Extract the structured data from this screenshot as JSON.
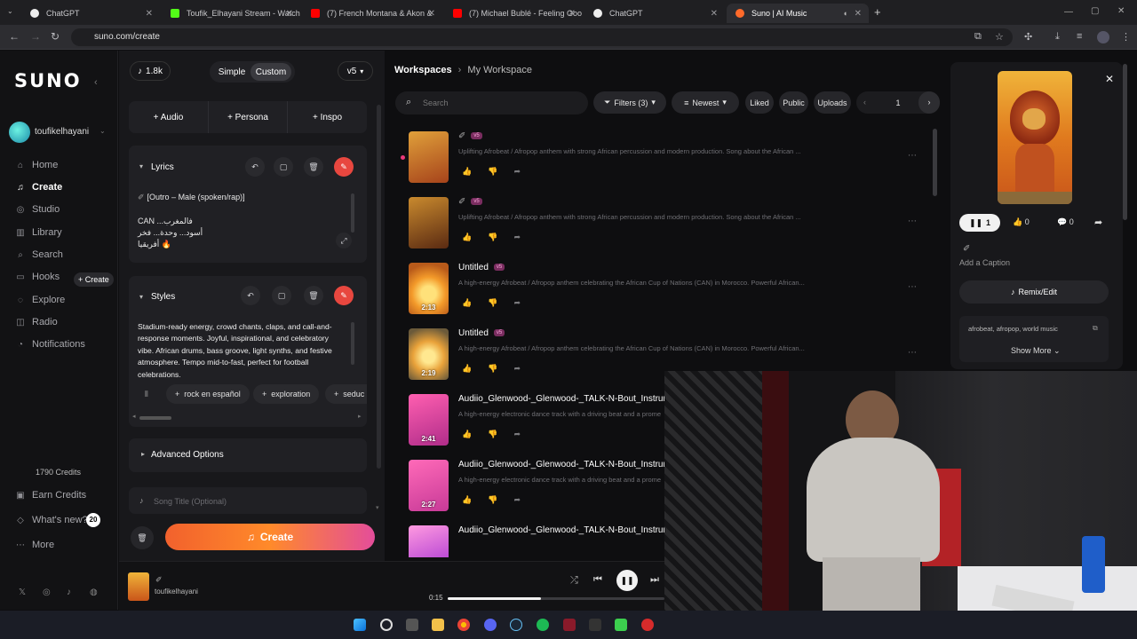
{
  "browser": {
    "tabs": [
      {
        "title": "ChatGPT",
        "color": "#1e1e1e"
      },
      {
        "title": "Toufik_Elhayani Stream - Watch",
        "color": "#53fc18"
      },
      {
        "title": "(7) French Montana & Akon &",
        "color": "#ff0000"
      },
      {
        "title": "(7) Michael Bublé - Feeling Goo",
        "color": "#ff0000"
      },
      {
        "title": "ChatGPT",
        "color": "#1e1e1e"
      },
      {
        "title": "Suno | AI Music",
        "color": "#ff6a2a"
      }
    ],
    "url": "suno.com/create"
  },
  "nav": {
    "logo": "SUNO",
    "username": "toufikelhayani",
    "items": [
      {
        "label": "Home",
        "icon": "home-icon",
        "glyph": "⌂"
      },
      {
        "label": "Create",
        "icon": "music-note-icon",
        "glyph": "♫"
      },
      {
        "label": "Studio",
        "icon": "studio-icon",
        "glyph": "◎"
      },
      {
        "label": "Library",
        "icon": "library-icon",
        "glyph": "▥"
      },
      {
        "label": "Search",
        "icon": "search-icon",
        "glyph": "⌕"
      },
      {
        "label": "Hooks",
        "icon": "hooks-icon",
        "glyph": "▭"
      },
      {
        "label": "Explore",
        "icon": "explore-icon",
        "glyph": "◌"
      },
      {
        "label": "Radio",
        "icon": "radio-icon",
        "glyph": "◫"
      },
      {
        "label": "Notifications",
        "icon": "bell-icon",
        "glyph": "◔"
      }
    ],
    "create_pill": "+ Create",
    "credits": "1790 Credits",
    "earn_credits": "Earn Credits",
    "whats_new": "What's new?",
    "whats_new_count": "20",
    "more": "More"
  },
  "create": {
    "song_count": "1.8k",
    "mode_simple": "Simple",
    "mode_custom": "Custom",
    "version": "v5",
    "audio": "+ Audio",
    "persona": "+ Persona",
    "inspo": "+ Inspo",
    "lyrics_label": "Lyrics",
    "lyrics_line1": "[Outro – Male (spoken/rap)]",
    "lyrics_line2": "CAN ...فالمغرب",
    "lyrics_line3": "أسود... وحدة... فخر",
    "lyrics_line4": "أفريقيا 🔥",
    "styles_label": "Styles",
    "styles_text": "Stadium-ready energy, crowd chants, claps, and call-and-response moments. Joyful, inspirational, and celebratory vibe. African drums, bass groove, light synths, and festive atmosphere. Tempo mid-to-fast, perfect for football celebrations.",
    "tags": [
      "rock en español",
      "exploration",
      "seduc"
    ],
    "advanced": "Advanced Options",
    "song_title_placeholder": "Song Title (Optional)",
    "create_button": "Create"
  },
  "workspace": {
    "breadcrumb_root": "Workspaces",
    "breadcrumb_current": "My Workspace",
    "search_placeholder": "Search",
    "filters": "Filters (3)",
    "sort": "Newest",
    "liked": "Liked",
    "public": "Public",
    "uploads": "Uploads",
    "page": "1",
    "songs": [
      {
        "title": "",
        "badge": "v5",
        "desc": "Uplifting Afrobeat / Afropop anthem with strong African percussion and modern production. Song about the African ...",
        "duration": "",
        "thumb": "lion"
      },
      {
        "title": "",
        "badge": "v5",
        "desc": "Uplifting Afrobeat / Afropop anthem with strong African percussion and modern production. Song about the African ...",
        "duration": "",
        "thumb": "lion-dark"
      },
      {
        "title": "Untitled",
        "badge": "v5",
        "desc": "A high-energy Afrobeat / Afropop anthem celebrating the African Cup of Nations (CAN) in Morocco. Powerful African...",
        "duration": "2:13",
        "thumb": "sunset"
      },
      {
        "title": "Untitled",
        "badge": "v5",
        "desc": "A high-energy Afrobeat / Afropop anthem celebrating the African Cup of Nations (CAN) in Morocco. Powerful African...",
        "duration": "2:19",
        "thumb": "sunset2"
      },
      {
        "title": "Audiio_Glenwood-_Glenwood-_TALK-N-Bout_Instrumental",
        "badge": "",
        "desc": "A high-energy electronic dance track with a driving beat and a prome",
        "duration": "2:41",
        "thumb": "pink"
      },
      {
        "title": "Audiio_Glenwood-_Glenwood-_TALK-N-Bout_Instrumental",
        "badge": "",
        "desc": "A high-energy electronic dance track with a driving beat and a prome",
        "duration": "2:27",
        "thumb": "pink2"
      },
      {
        "title": "Audiio_Glenwood-_Glenwood-_TALK-N-Bout_Instrumental",
        "badge": "",
        "desc": "",
        "duration": "",
        "thumb": "pink3"
      }
    ]
  },
  "detail": {
    "play_count": "1",
    "likes": "0",
    "comments": "0",
    "add_caption": "Add a Caption",
    "remix": "Remix/Edit",
    "tags_text": "afrobeat, afropop, world music",
    "show_more": "Show More"
  },
  "player": {
    "artist": "toufikelhayani",
    "time": "0:15",
    "progress": 0.43
  }
}
